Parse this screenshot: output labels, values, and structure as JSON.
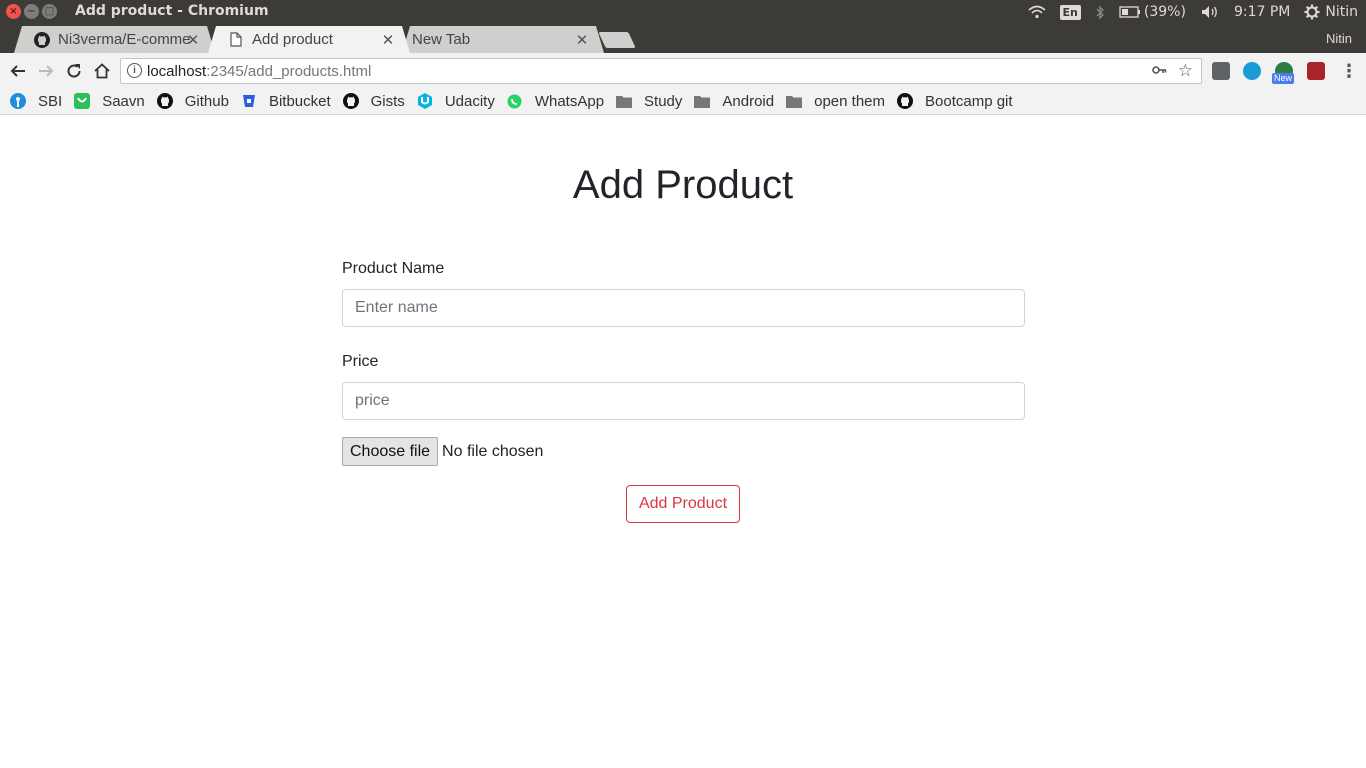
{
  "os": {
    "window_title": "Add product - Chromium",
    "keyboard_layout": "En",
    "battery": "(39%)",
    "time": "9:17 PM",
    "user": "Nitin"
  },
  "tabs": [
    {
      "label": "Ni3verma/E-comme",
      "favicon": "github-icon",
      "active": false
    },
    {
      "label": "Add product",
      "favicon": "page-icon",
      "active": true
    },
    {
      "label": "New Tab",
      "favicon": "",
      "active": false
    }
  ],
  "profile_name": "Nitin",
  "omnibox": {
    "host": "localhost",
    "path": ":2345/add_products.html"
  },
  "extensions": {
    "new_badge": "New"
  },
  "bookmarks": [
    {
      "label": "SBI",
      "icon": "sbi-icon",
      "color": "#1f8fdc"
    },
    {
      "label": "Saavn",
      "icon": "saavn-icon",
      "color": "#2bc05a"
    },
    {
      "label": "Github",
      "icon": "github-icon",
      "color": "#111111"
    },
    {
      "label": "Bitbucket",
      "icon": "bitbucket-icon",
      "color": "#2a5fe0"
    },
    {
      "label": "Gists",
      "icon": "github-icon",
      "color": "#111111"
    },
    {
      "label": "Udacity",
      "icon": "udacity-icon",
      "color": "#02b3e4"
    },
    {
      "label": "WhatsApp",
      "icon": "whatsapp-icon",
      "color": "#25d366"
    },
    {
      "label": "Study",
      "icon": "folder-icon",
      "color": "#777777"
    },
    {
      "label": "Android",
      "icon": "folder-icon",
      "color": "#777777"
    },
    {
      "label": "open them",
      "icon": "folder-icon",
      "color": "#777777"
    },
    {
      "label": "Bootcamp git",
      "icon": "github-icon",
      "color": "#111111"
    }
  ],
  "page": {
    "title": "Add Product",
    "name_label": "Product Name",
    "name_placeholder": "Enter name",
    "price_label": "Price",
    "price_placeholder": "price",
    "file_button": "Choose file",
    "file_status": "No file chosen",
    "submit_label": "Add Product",
    "accent_color": "#dc3545"
  }
}
